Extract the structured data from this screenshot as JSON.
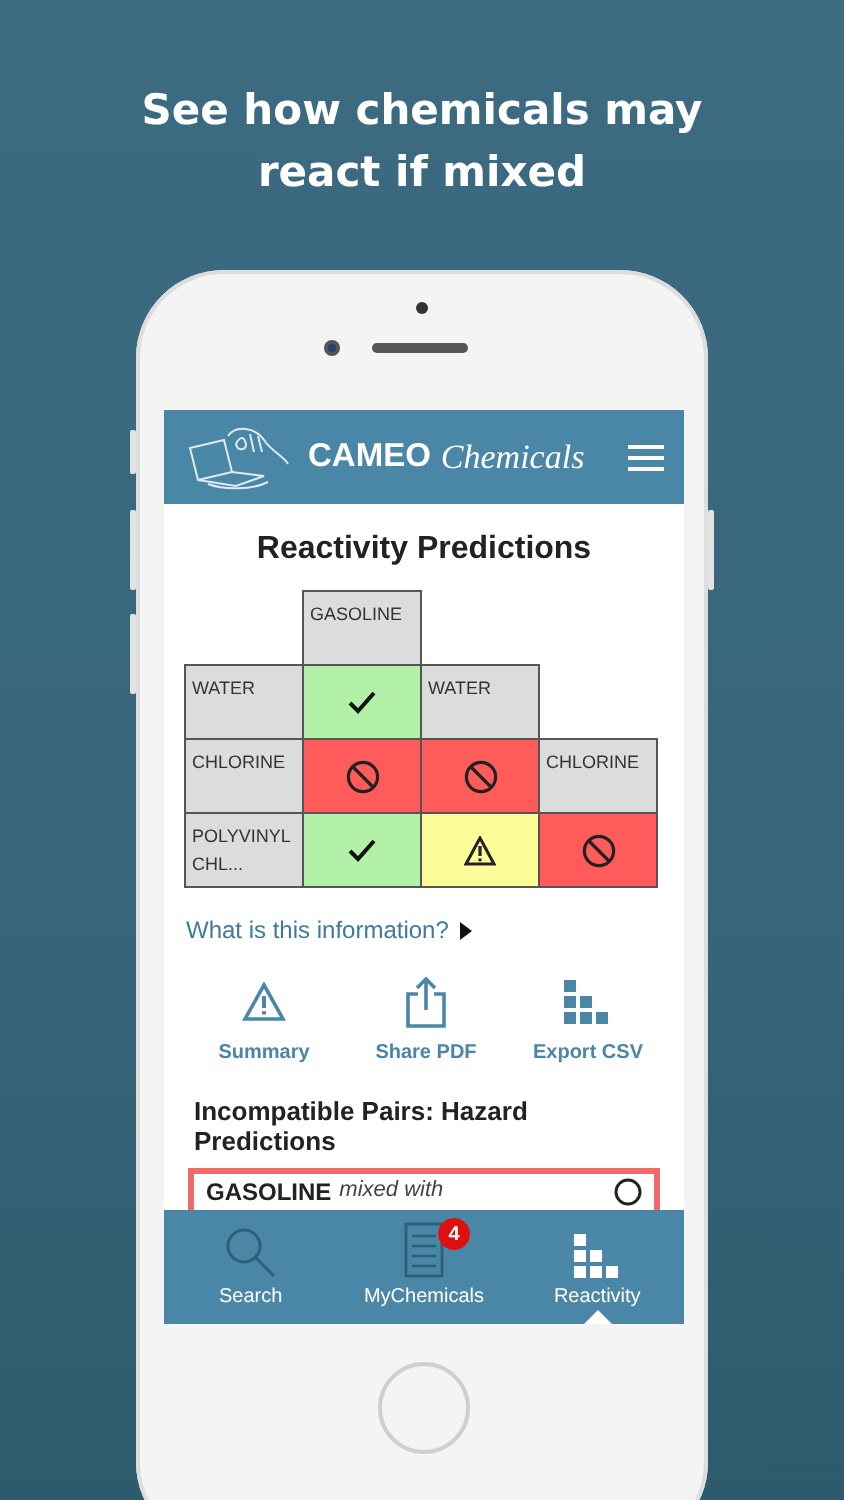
{
  "headline": "See how chemicals may react if mixed",
  "header": {
    "brand": "CAMEO",
    "product": "Chemicals"
  },
  "title": "Reactivity Predictions",
  "matrix": {
    "top_label": "GASOLINE",
    "rows": [
      {
        "label": "WATER",
        "results": [
          {
            "kind": "compatible"
          }
        ],
        "diagonal": "WATER"
      },
      {
        "label": "CHLORINE",
        "results": [
          {
            "kind": "incompatible"
          },
          {
            "kind": "incompatible"
          }
        ],
        "diagonal": "CHLORINE"
      },
      {
        "label": "POLYVINYL CHL...",
        "results": [
          {
            "kind": "compatible"
          },
          {
            "kind": "caution"
          },
          {
            "kind": "incompatible"
          }
        ]
      }
    ]
  },
  "info_link": "What is this information?",
  "actions": [
    {
      "kind": "summary",
      "label": "Summary"
    },
    {
      "kind": "share",
      "label": "Share PDF"
    },
    {
      "kind": "export",
      "label": "Export CSV"
    }
  ],
  "section_heading": "Incompatible Pairs: Hazard Predictions",
  "pair": {
    "chemical": "GASOLINE",
    "relation": "mixed with"
  },
  "tabs": [
    {
      "kind": "search",
      "label": "Search",
      "selected": false
    },
    {
      "kind": "list",
      "label": "MyChemicals",
      "selected": false,
      "badge": "4"
    },
    {
      "kind": "reactivity",
      "label": "Reactivity",
      "selected": true
    }
  ]
}
